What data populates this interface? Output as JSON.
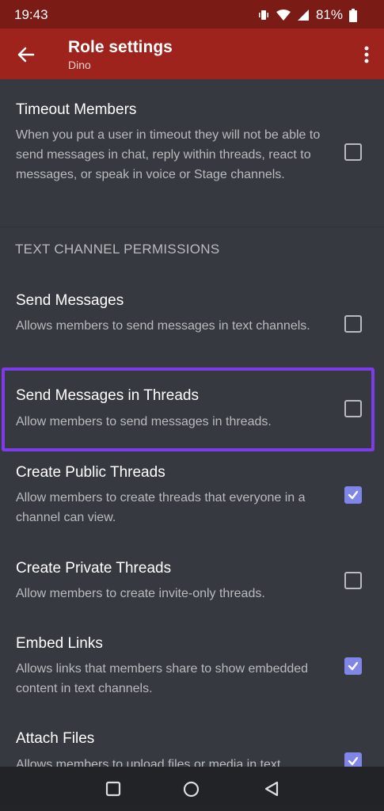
{
  "status_bar": {
    "time": "19:43",
    "battery": "81%"
  },
  "app_bar": {
    "title": "Role settings",
    "subtitle": "Dino"
  },
  "section_header": "TEXT CHANNEL PERMISSIONS",
  "permissions": [
    {
      "name": "Timeout Members",
      "description": "When you put a user in timeout they will not be able to send messages in chat, reply within threads, react to messages, or speak in voice or Stage channels.",
      "checked": false
    },
    {
      "name": "Send Messages",
      "description": "Allows members to send messages in text channels.",
      "checked": false
    },
    {
      "name": "Send Messages in Threads",
      "description": "Allow members to send messages in threads.",
      "checked": false,
      "highlighted": true
    },
    {
      "name": "Create Public Threads",
      "description": "Allow members to create threads that everyone in a channel can view.",
      "checked": true
    },
    {
      "name": "Create Private Threads",
      "description": "Allow members to create invite-only threads.",
      "checked": false
    },
    {
      "name": "Embed Links",
      "description": "Allows links that members share to show embedded content in text channels.",
      "checked": true
    },
    {
      "name": "Attach Files",
      "description": "Allows members to upload files or media in text channels.",
      "checked": true
    }
  ],
  "colors": {
    "background": "#36393f",
    "app_bar": "#9d231c",
    "status_bar": "#7a1b16",
    "checkbox_checked": "#7f86e8",
    "highlight": "#7d3bea"
  }
}
